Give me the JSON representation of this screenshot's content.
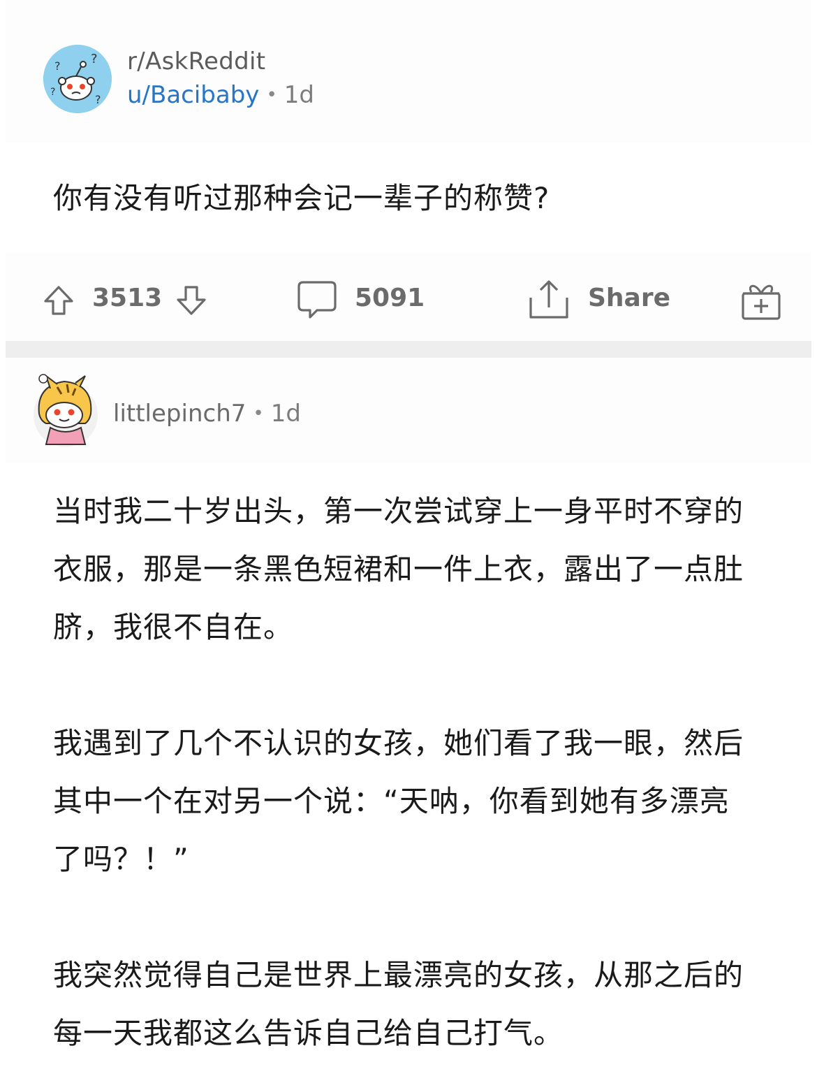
{
  "post": {
    "subreddit": "r/AskReddit",
    "author": "u/Bacibaby",
    "separator": "•",
    "age": "1d",
    "title": "你有没有听过那种会记一辈子的称赞?",
    "avatar_icon": "snoo-question-avatar-icon"
  },
  "actions": {
    "upvote_icon": "upvote-arrow-icon",
    "score": "3513",
    "downvote_icon": "downvote-arrow-icon",
    "comment_icon": "comment-bubble-icon",
    "comments": "5091",
    "share_icon": "share-icon",
    "share_label": "Share",
    "award_icon": "gift-award-icon"
  },
  "comment": {
    "author": "littlepinch7",
    "separator": "•",
    "age": "1d",
    "avatar_icon": "snoo-tiger-avatar-icon",
    "paragraphs": [
      "当时我二十岁出头，第一次尝试穿上一身平时不穿的衣服，那是一条黑色短裙和一件上衣，露出了一点肚脐，我很不自在。",
      "我遇到了几个不认识的女孩，她们看了我一眼，然后其中一个在对另一个说：“天呐，你看到她有多漂亮了吗？！”",
      "我突然觉得自己是世界上最漂亮的女孩，从那之后的每一天我都这么告诉自己给自己打气。"
    ]
  },
  "colors": {
    "author_blue": "#2675c6",
    "icon_gray": "#6b6b6b",
    "divider": "#eeeeee"
  }
}
